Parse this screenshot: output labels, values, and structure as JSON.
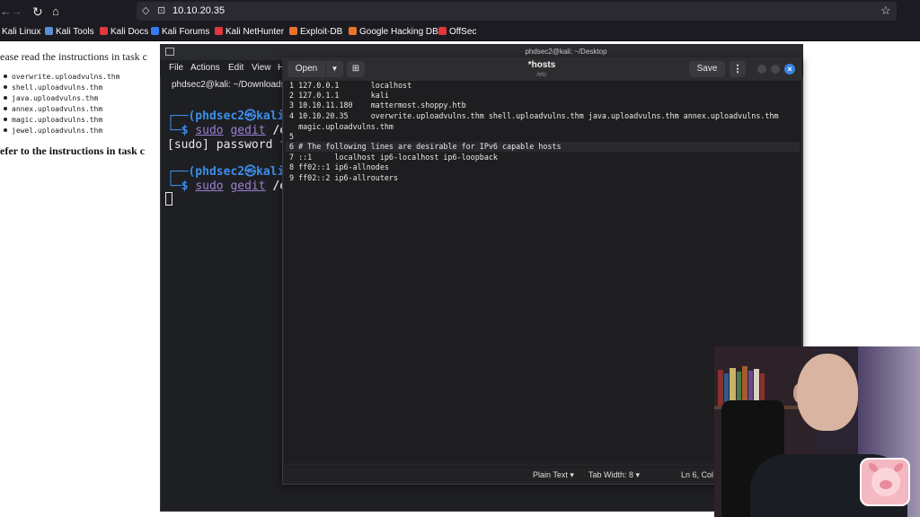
{
  "browser": {
    "url": "10.10.20.35",
    "nav_icons": [
      "back-arrow-icon",
      "forward-arrow-icon",
      "reload-icon",
      "home-icon"
    ],
    "bookmarks": [
      {
        "label": "Kali Linux",
        "icon": "kali-icon",
        "color": "#367bf0"
      },
      {
        "label": "Kali Tools",
        "icon": "kali-tools-icon",
        "color": "#5a8fd6"
      },
      {
        "label": "Kali Docs",
        "icon": "kali-docs-icon",
        "color": "#e0383e"
      },
      {
        "label": "Kali Forums",
        "icon": "kali-forums-icon",
        "color": "#367bf0"
      },
      {
        "label": "Kali NetHunter",
        "icon": "nethunter-icon",
        "color": "#e0383e"
      },
      {
        "label": "Exploit-DB",
        "icon": "exploit-db-icon",
        "color": "#e8732c"
      },
      {
        "label": "Google Hacking DB",
        "icon": "ghdb-icon",
        "color": "#e8732c"
      },
      {
        "label": "OffSec",
        "icon": "offsec-icon",
        "color": "#e0383e"
      }
    ]
  },
  "webpage": {
    "intro": "ease read the instructions in task c",
    "hosts": [
      "overwrite.uploadvulns.thm",
      "shell.uploadvulns.thm",
      "java.uploadvulns.thm",
      "annex.uploadvulns.thm",
      "magic.uploadvulns.thm",
      "jewel.uploadvulns.thm"
    ],
    "refer": "efer to the instructions in task c"
  },
  "terminal": {
    "title": "phdsec2@kali: ~/Desktop",
    "menu": [
      "File",
      "Actions",
      "Edit",
      "View",
      "H"
    ],
    "tab_label": "phdsec2@kali: ~/Downloads",
    "prompt_user": "(phdsec2㉿kali",
    "cmd_prefix": "sudo",
    "cmd_name": "gedit",
    "cmd_arg": "/e",
    "password_line": "[sudo] password f"
  },
  "gedit": {
    "open_label": "Open",
    "save_label": "Save",
    "doc_title": "*hosts",
    "doc_path": "/etc",
    "lines": [
      "1 127.0.0.1       localhost",
      "2 127.0.1.1       kali",
      "3 10.10.11.180    mattermost.shoppy.htb",
      "4 10.10.20.35     overwrite.uploadvulns.thm shell.uploadvulns.thm java.uploadvulns.thm annex.uploadvulns.thm",
      "  magic.uploadvulns.thm",
      "5",
      "6 # The following lines are desirable for IPv6 capable hosts",
      "7 ::1     localhost ip6-localhost ip6-loopback",
      "8 ff02::1 ip6-allnodes",
      "9 ff02::2 ip6-allrouters"
    ],
    "status": {
      "syntax": "Plain Text",
      "tab_width": "Tab Width: 8",
      "position": "Ln 6, Col"
    }
  },
  "colors": {
    "terminal_prompt": "#3b8eea",
    "terminal_command": "#9b7fd4",
    "gedit_close": "#3584e4"
  }
}
